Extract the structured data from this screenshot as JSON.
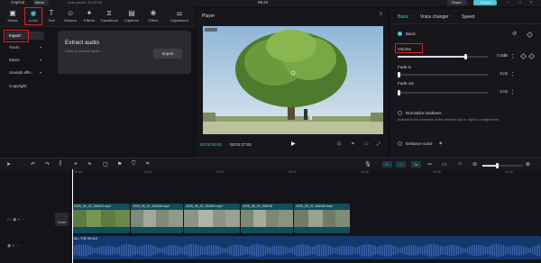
{
  "topbar": {
    "app_name": "CapCut",
    "menu": "Menu",
    "autosave": "Auto saved: 20:10:08",
    "project": "08.22",
    "share": "Share",
    "export": "Export"
  },
  "toolbar": {
    "tools": [
      {
        "label": "Media",
        "icon": "media-icon"
      },
      {
        "label": "Audio",
        "icon": "audio-icon"
      },
      {
        "label": "Text",
        "icon": "text-icon"
      },
      {
        "label": "Stickers",
        "icon": "sticker-icon"
      },
      {
        "label": "Effects",
        "icon": "effects-icon"
      },
      {
        "label": "Transitions",
        "icon": "transitions-icon"
      },
      {
        "label": "Captions",
        "icon": "captions-icon"
      },
      {
        "label": "Filters",
        "icon": "filters-icon"
      },
      {
        "label": "Adjustment",
        "icon": "adjustment-icon"
      }
    ],
    "active": "Audio"
  },
  "leftnav": {
    "items": [
      {
        "label": "Import",
        "selected": true
      },
      {
        "label": "Yours",
        "dropdown": true
      },
      {
        "label": "Music",
        "dropdown": true
      },
      {
        "label": "Sounds effe...",
        "dropdown": true
      },
      {
        "label": "Copyright",
        "dropdown": false
      }
    ]
  },
  "media": {
    "title": "Extract audio",
    "subtitle": "Video to extract audio",
    "import_button": "Import"
  },
  "player": {
    "title": "Player",
    "current_time": "00:00:00:00",
    "total_time": "00:02:27:02"
  },
  "right_panel": {
    "tabs": [
      "Basic",
      "Voice changer",
      "Speed"
    ],
    "active_tab": "Basic",
    "section": "Basic",
    "volume_label": "Volume",
    "volume_value": "0.0dB",
    "volume_level": 0.75,
    "fade_in_label": "Fade in",
    "fade_in_value": "0.0s",
    "fade_out_label": "Fade out",
    "fade_out_value": "0.0s",
    "normalize_label": "Normalize loudness",
    "normalize_desc": "Normalize the loudness of the selected clip or clips to a target level.",
    "enhance_label": "Enhance voice"
  },
  "timeline": {
    "ruler_labels": [
      "00:00",
      "00:10",
      "00:20",
      "00:30",
      "00:40",
      "00:50",
      "01:00"
    ],
    "video_clips": [
      {
        "name": "2025_06_22_164512.mp4",
        "duration": "00:"
      },
      {
        "name": "2025_06_22_164440.mp4",
        "duration": "00:"
      },
      {
        "name": "2025_06_22_164491.mp4",
        "duration": "00:"
      },
      {
        "name": "2025_06_22_164518",
        "duration": ""
      },
      {
        "name": "2025_06_22_164440.mp4",
        "duration": "00:"
      }
    ],
    "cover_label": "Cover",
    "audio_clip": "ALL THE WHILE"
  },
  "colors": {
    "accent": "#4ec3d8",
    "highlight": "#e21f26",
    "audio_track": "#14386e",
    "video_track": "#0f4e5c"
  }
}
